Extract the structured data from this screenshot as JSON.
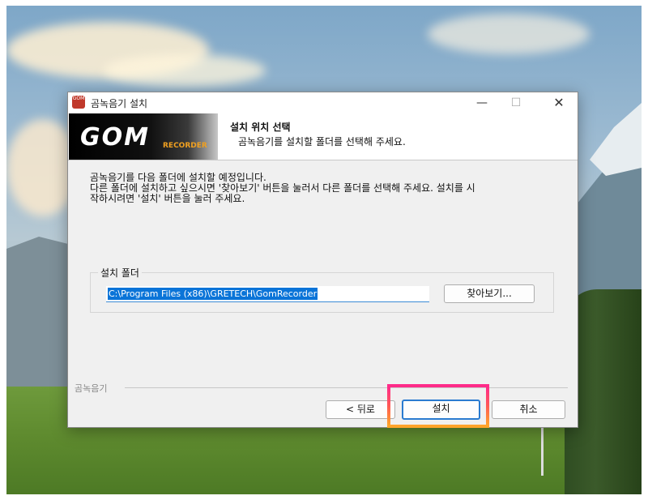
{
  "window": {
    "title": "곰녹음기 설치",
    "app_icon_text": "GOM",
    "minimize": "—",
    "maximize": "☐",
    "close": "✕"
  },
  "header": {
    "logo_text": "GOM",
    "logo_sub": "RECORDER",
    "title": "설치 위치 선택",
    "subtitle": "곰녹음기를 설치할 폴더를 선택해 주세요."
  },
  "intro": {
    "line1": "곰녹음기를 다음 폴더에 설치할 예정입니다.",
    "line2": "다른 폴더에 설치하고 싶으시면 '찾아보기' 버튼을 눌러서 다른 폴더를 선택해 주세요. 설치를 시",
    "line3": "작하시려면 '설치' 버튼을 눌러 주세요."
  },
  "folder": {
    "group_label": "설치 폴더",
    "path": "C:\\Program Files (x86)\\GRETECH\\GomRecorder",
    "browse_label": "찾아보기..."
  },
  "footer": {
    "brand": "곰녹음기",
    "back_label": "< 뒤로",
    "install_label": "설치",
    "cancel_label": "취소"
  },
  "colors": {
    "highlight_top": "#ff2a8a",
    "highlight_bottom": "#ffa52a",
    "selection": "#0a74d8"
  }
}
